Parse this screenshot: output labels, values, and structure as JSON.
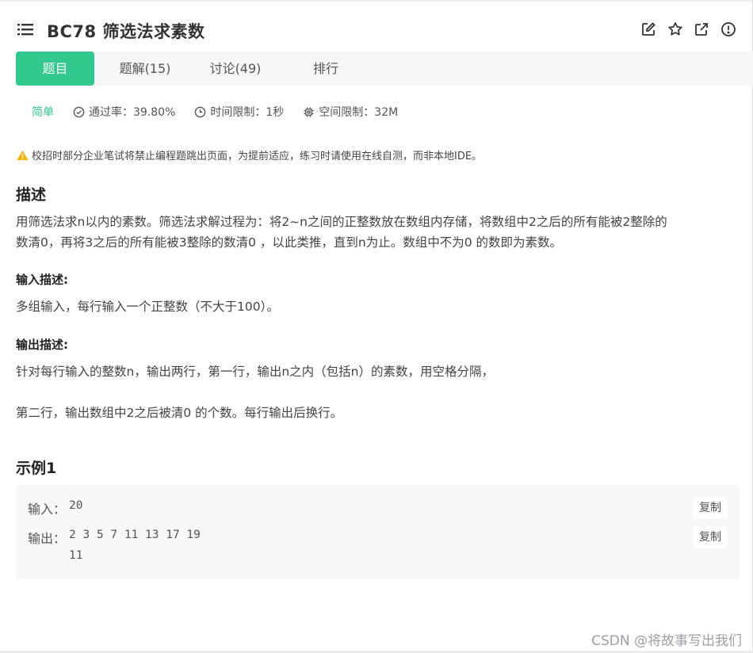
{
  "header": {
    "title": "BC78  筛选法求素数",
    "icons": [
      "menu-list-icon",
      "edit-icon",
      "star-icon",
      "share-icon",
      "info-icon"
    ]
  },
  "tabs": [
    {
      "label": "题目",
      "active": true
    },
    {
      "label": "题解(15)",
      "active": false
    },
    {
      "label": "讨论(49)",
      "active": false
    },
    {
      "label": "排行",
      "active": false
    }
  ],
  "meta": {
    "difficulty": "简单",
    "pass_rate": "通过率：39.80%",
    "time_limit": "时间限制：1秒",
    "memory_limit": "空间限制：32M"
  },
  "notice": "校招时部分企业笔试将禁止编程题跳出页面，为提前适应，练习时请使用在线自测，而非本地IDE。",
  "description": {
    "title": "描述",
    "line1": "用筛选法求n以内的素数。筛选法求解过程为：将2~n之间的正整数放在数组内存储，将数组中2之后的所有能被2整除的",
    "line2": "数清0，再将3之后的所有能被3整除的数清0 ，以此类推，直到n为止。数组中不为0 的数即为素数。"
  },
  "input_desc": {
    "title": "输入描述:",
    "text": "多组输入，每行输入一个正整数（不大于100）。"
  },
  "output_desc": {
    "title": "输出描述:",
    "line1": "针对每行输入的整数n，输出两行，第一行，输出n之内（包括n）的素数，用空格分隔，",
    "line2": "第二行，输出数组中2之后被清0 的个数。每行输出后换行。"
  },
  "example": {
    "title": "示例1",
    "input_label": "输入：",
    "input_value": "20",
    "output_label": "输出：",
    "output_line1": "2 3 5 7 11 13 17 19",
    "output_line2": "11",
    "copy_label": "复制"
  },
  "watermark": "CSDN @将故事写出我们",
  "colors": {
    "accent": "#32c98f",
    "warning": "#f5b400",
    "tab_bg": "#f4f6f8",
    "example_bg": "#f6f7f9"
  }
}
